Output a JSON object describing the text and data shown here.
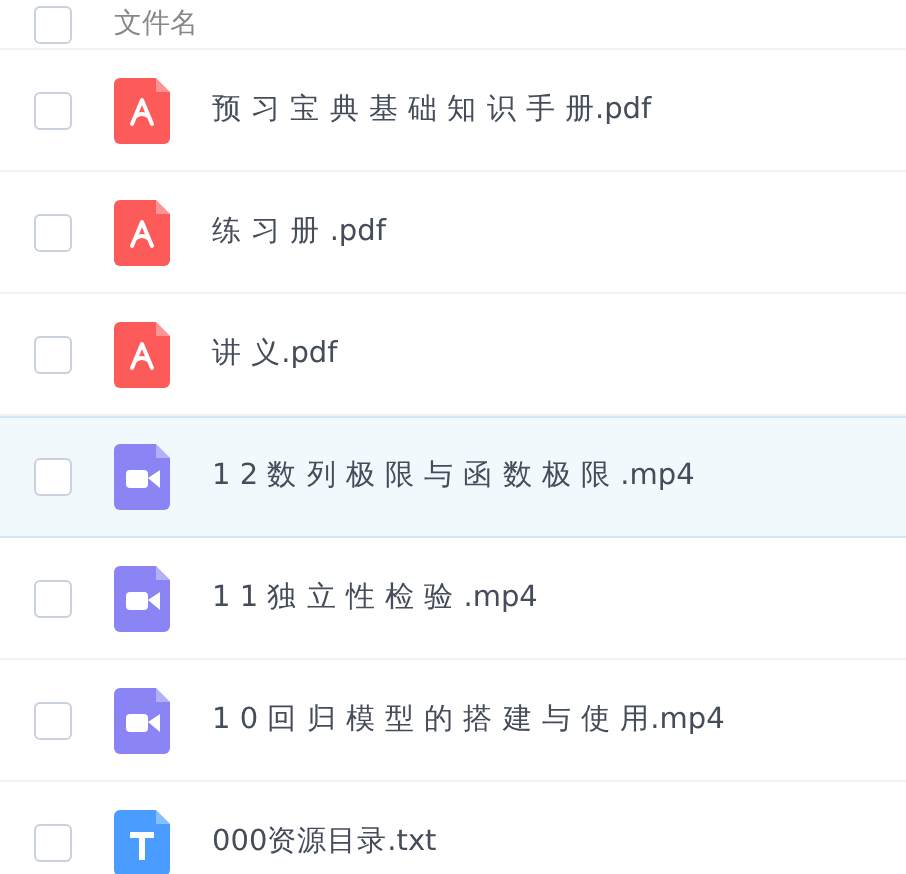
{
  "header": {
    "label": "文件名",
    "checked": false
  },
  "files": [
    {
      "name": "预 习 宝 典 基 础 知 识 手 册.pdf",
      "kind": "pdf",
      "checked": false,
      "highlighted": false
    },
    {
      "name": "练 习 册 .pdf",
      "kind": "pdf",
      "checked": false,
      "highlighted": false
    },
    {
      "name": "讲 义.pdf",
      "kind": "pdf",
      "checked": false,
      "highlighted": false
    },
    {
      "name": "1 2 数 列 极 限 与 函 数 极 限 .mp4",
      "kind": "video",
      "checked": false,
      "highlighted": true
    },
    {
      "name": "1 1 独 立 性 检 验 .mp4",
      "kind": "video",
      "checked": false,
      "highlighted": false
    },
    {
      "name": "1 0 回 归 模 型 的 搭 建 与 使 用.mp4",
      "kind": "video",
      "checked": false,
      "highlighted": false
    },
    {
      "name": "000资源目录.txt",
      "kind": "text",
      "checked": false,
      "highlighted": false
    }
  ]
}
